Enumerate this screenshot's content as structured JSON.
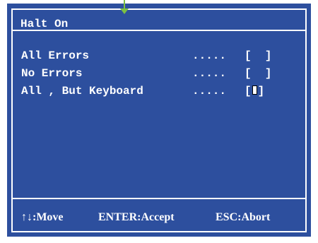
{
  "dialog": {
    "title": "Halt On",
    "options": [
      {
        "label": "All Errors",
        "dots": ".....",
        "open": "[",
        "value": " ",
        "close": "]"
      },
      {
        "label": "No Errors",
        "dots": ".....",
        "open": "[",
        "value": " ",
        "close": "]"
      },
      {
        "label": "All , But Keyboard",
        "dots": ".....",
        "open": "[",
        "value": "",
        "close": "]"
      }
    ],
    "footer": {
      "move_label": "↑↓:Move",
      "accept_label": "ENTER:Accept",
      "abort_label": "ESC:Abort"
    }
  },
  "colors": {
    "background": "#2d4f9e",
    "foreground": "#ffffff",
    "pointer": "#7cc142"
  },
  "icons": {
    "pointer": "down-arrow-icon"
  }
}
